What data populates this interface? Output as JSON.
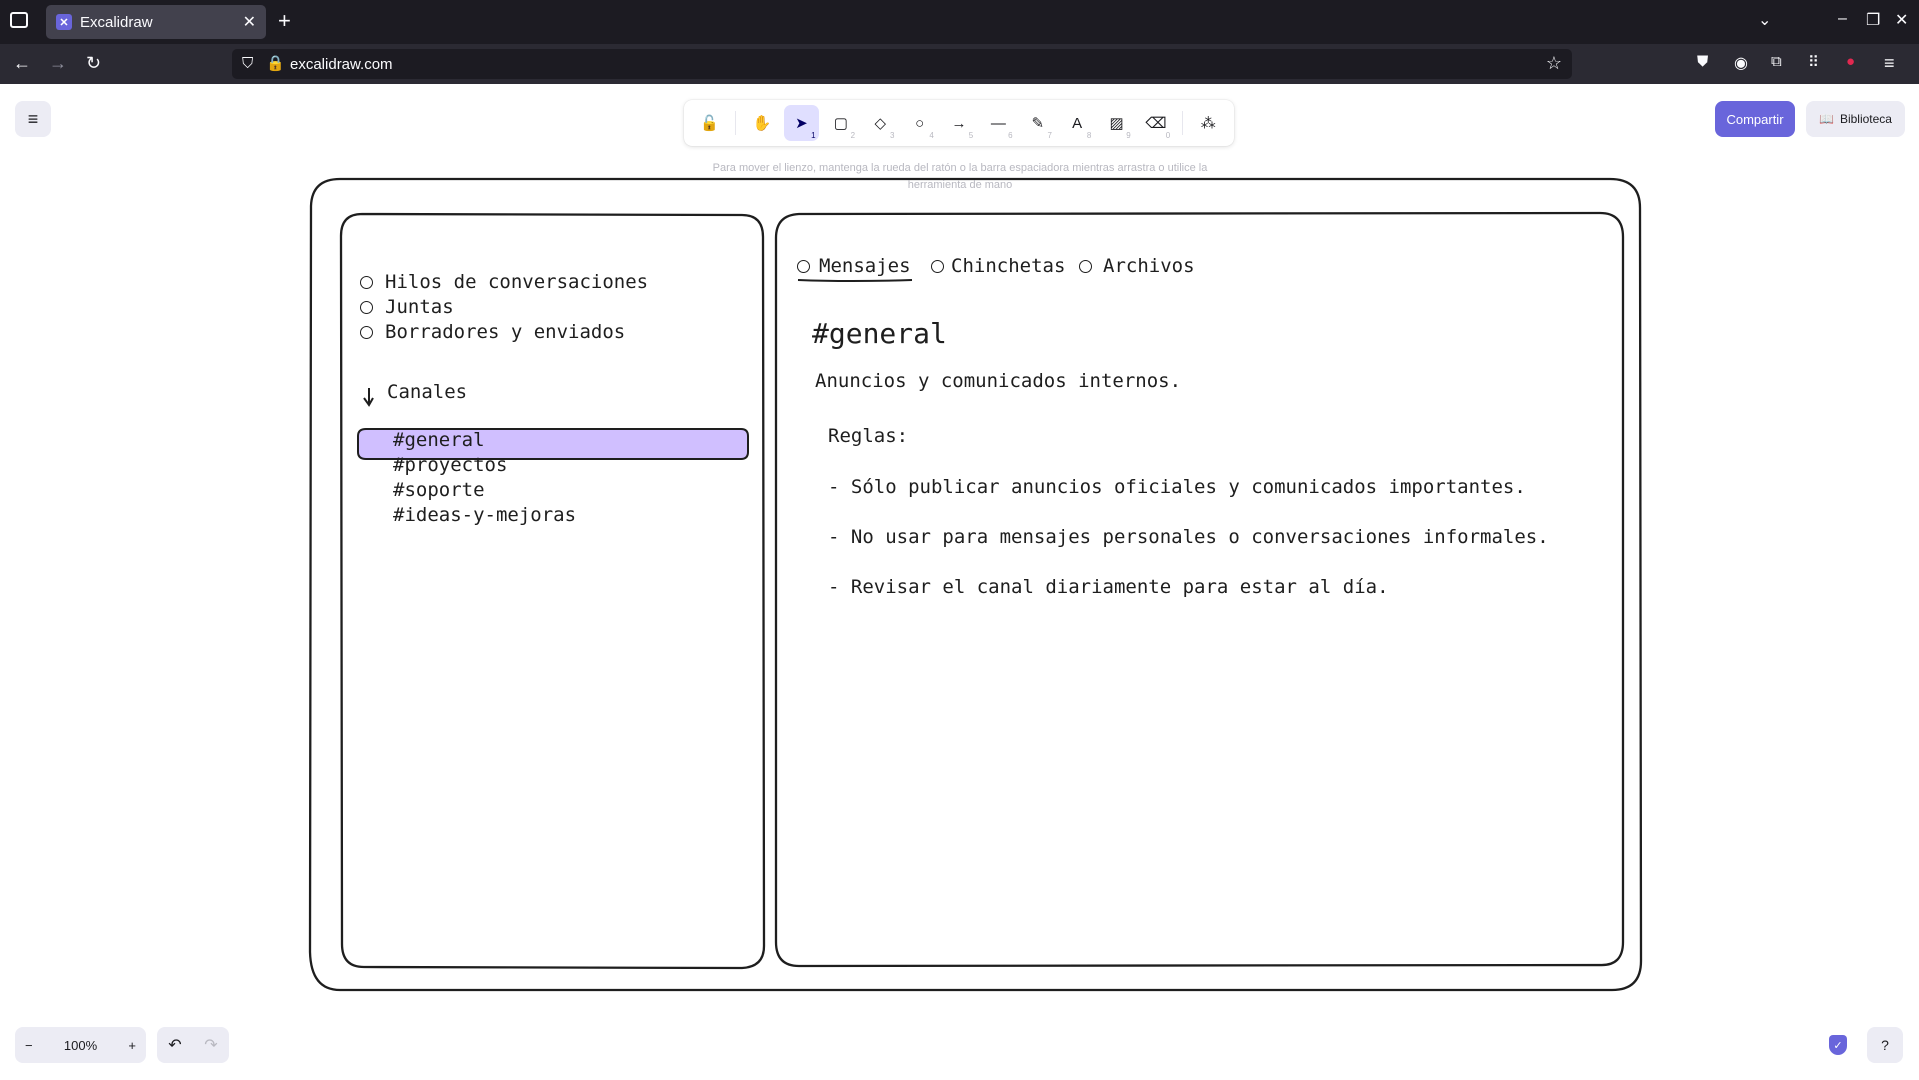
{
  "browser": {
    "tab_title": "Excalidraw",
    "tab_favicon": "excalidraw-icon",
    "url": "excalidraw.com"
  },
  "toolbar": {
    "tools": [
      {
        "name": "lock-icon",
        "glyph": "🔓",
        "key": ""
      },
      {
        "name": "hand-icon",
        "glyph": "✋",
        "key": ""
      },
      {
        "name": "selection-icon",
        "glyph": "➤",
        "key": "1"
      },
      {
        "name": "rectangle-icon",
        "glyph": "▢",
        "key": "2"
      },
      {
        "name": "diamond-icon",
        "glyph": "◇",
        "key": "3"
      },
      {
        "name": "ellipse-icon",
        "glyph": "○",
        "key": "4"
      },
      {
        "name": "arrow-icon",
        "glyph": "→",
        "key": "5"
      },
      {
        "name": "line-icon",
        "glyph": "—",
        "key": "6"
      },
      {
        "name": "pencil-icon",
        "glyph": "✎",
        "key": "7"
      },
      {
        "name": "text-icon",
        "glyph": "A",
        "key": "8"
      },
      {
        "name": "image-icon",
        "glyph": "▨",
        "key": "9"
      },
      {
        "name": "eraser-icon",
        "glyph": "⌫",
        "key": "0"
      },
      {
        "name": "extra-tools-icon",
        "glyph": "⁂",
        "key": ""
      }
    ],
    "active_tool": "selection-icon",
    "hint": "Para mover el lienzo, mantenga la rueda del ratón o la barra espaciadora mientras arrastra o utilice la herramienta de mano"
  },
  "actions": {
    "share_label": "Compartir",
    "library_label": "Biblioteca"
  },
  "canvas": {
    "sidebar": {
      "nav": [
        "Hilos de conversaciones",
        "Juntas",
        "Borradores y enviados"
      ],
      "channels_header": "Canales",
      "channels": [
        "#general",
        "#proyectos",
        "#soporte",
        "#ideas-y-mejoras"
      ],
      "selected_channel": "#general",
      "highlight_color": "#d0bfff"
    },
    "main": {
      "tabs": [
        "Mensajes",
        "Chinchetas",
        "Archivos"
      ],
      "active_tab": "Mensajes",
      "channel_title": "#general",
      "description": "Anuncios y comunicados internos.",
      "rules_title": "Reglas:",
      "rules": [
        "- Sólo publicar anuncios oficiales y comunicados importantes.",
        "- No usar para mensajes personales o conversaciones informales.",
        "- Revisar el canal diariamente para estar al día."
      ]
    }
  },
  "footer": {
    "zoom": "100%"
  }
}
